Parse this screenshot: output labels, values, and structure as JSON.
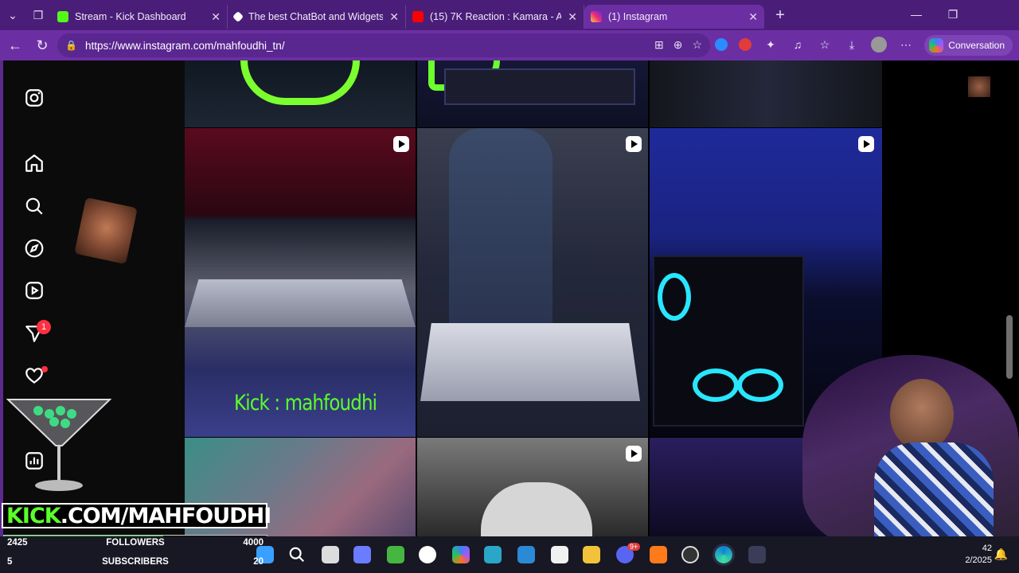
{
  "browser": {
    "tabs": [
      {
        "title": "Stream - Kick Dashboard",
        "favicon_color": "#53fc18",
        "active": false
      },
      {
        "title": "The best ChatBot and Widgets for",
        "favicon_color": "#ffffff",
        "active": false
      },
      {
        "title": "(15) 7K Reaction : Kamara - AI Mot",
        "favicon_color": "#ff0000",
        "active": false
      },
      {
        "title": "(1) Instagram",
        "favicon_color": "#e1306c",
        "active": true
      }
    ],
    "new_tab": "+",
    "url": "https://www.instagram.com/mahfoudhi_tn/",
    "conversation_label": "Conversation"
  },
  "instagram": {
    "notifications_badge": "1",
    "icons": [
      "instagram-logo-icon",
      "home-icon",
      "search-icon",
      "explore-icon",
      "reels-icon",
      "messages-icon",
      "heart-icon",
      "insights-icon"
    ],
    "post_caption": "Kick : mahfoudhi"
  },
  "overlay": {
    "kick_url_k": "KICK",
    "kick_url_rest": ".COM/MAHFOUDHI",
    "followers": {
      "current": "2425",
      "label": "FOLLOWERS",
      "goal": "4000",
      "progress": 0.606,
      "color": "#3fb83f"
    },
    "subscribers": {
      "current": "5",
      "label": "SUBSCRIBERS",
      "goal": "20",
      "progress": 0.25,
      "color": "#ff5fd2"
    }
  },
  "taskbar": {
    "clock_time": "42",
    "clock_date": "2/2025",
    "discord_badge": "9+"
  }
}
